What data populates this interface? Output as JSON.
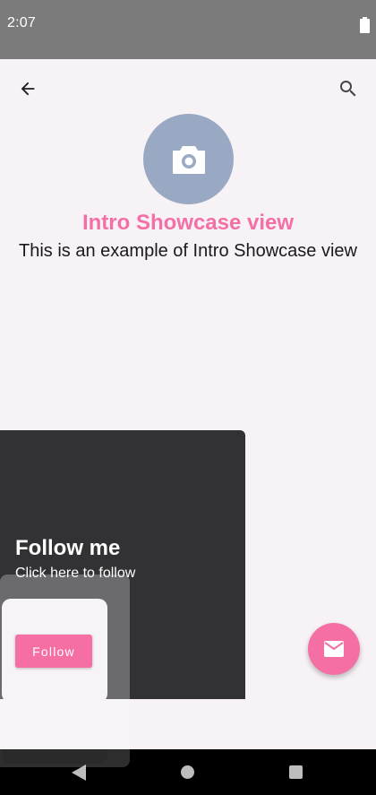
{
  "status_bar": {
    "time": "2:07",
    "battery_icon": "battery-full-icon"
  },
  "toolbar": {
    "back_icon": "arrow-back-icon",
    "search_icon": "search-icon"
  },
  "profile": {
    "avatar_icon": "camera-icon",
    "title": "Intro Showcase view",
    "description": "This is an example of Intro Showcase view"
  },
  "showcase": {
    "title": "Follow me",
    "subtitle": "Click here to follow"
  },
  "follow_button": {
    "label": "Follow"
  },
  "fab": {
    "icon": "mail-icon"
  },
  "nav_bar": {
    "back_icon": "nav-back-icon",
    "home_icon": "nav-home-icon",
    "recents_icon": "nav-recents-icon"
  },
  "colors": {
    "accent": "#f56fa4",
    "title": "#f46fa6",
    "avatar": "#9aa9c3",
    "showcase_bg": "#323134",
    "background": "#f6f2f6"
  }
}
